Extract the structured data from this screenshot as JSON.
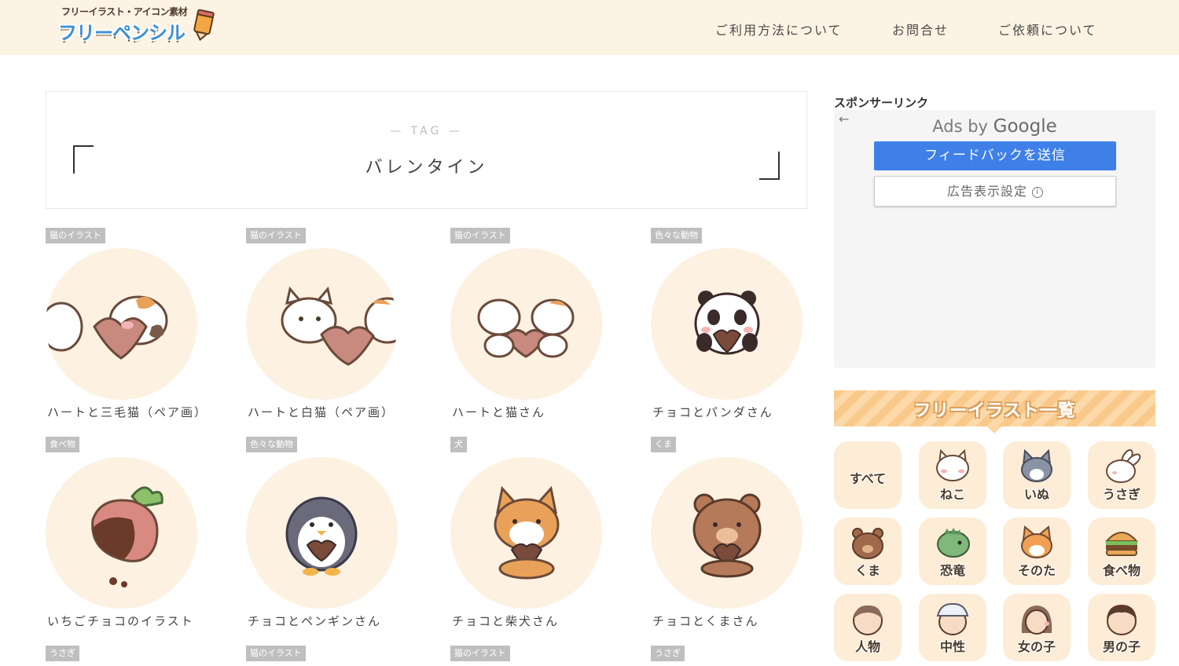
{
  "header": {
    "logo_sub": "フリーイラスト・アイコン素材",
    "logo_main": "フリーペンシル",
    "nav": [
      "ご利用方法について",
      "お問合せ",
      "ご依頼について"
    ]
  },
  "tag": {
    "label": "— TAG —",
    "title": "バレンタイン"
  },
  "cards": [
    {
      "category": "猫のイラスト",
      "title": "ハートと三毛猫（ペア画）",
      "icon": "calico-cat-heart-illustration"
    },
    {
      "category": "猫のイラスト",
      "title": "ハートと白猫（ペア画）",
      "icon": "white-cat-heart-illustration"
    },
    {
      "category": "猫のイラスト",
      "title": "ハートと猫さん",
      "icon": "cats-pair-heart-illustration"
    },
    {
      "category": "色々な動物",
      "title": "チョコとパンダさん",
      "icon": "panda-chocolate-illustration"
    },
    {
      "category": "食べ物",
      "title": "いちごチョコのイラスト",
      "icon": "strawberry-chocolate-illustration"
    },
    {
      "category": "色々な動物",
      "title": "チョコとペンギンさん",
      "icon": "penguin-chocolate-illustration"
    },
    {
      "category": "犬",
      "title": "チョコと柴犬さん",
      "icon": "shiba-chocolate-illustration"
    },
    {
      "category": "くま",
      "title": "チョコとくまさん",
      "icon": "bear-chocolate-illustration"
    },
    {
      "category": "うさぎ"
    },
    {
      "category": "猫のイラスト"
    },
    {
      "category": "猫のイラスト"
    },
    {
      "category": "うさぎ"
    }
  ],
  "sidebar": {
    "sponsor_label": "スポンサーリンク",
    "ads_by": "Ads by",
    "ads_google": "Google",
    "feedback_button": "フィードバックを送信",
    "ad_settings_button": "広告表示設定",
    "back_arrow": "←",
    "info_glyph": "i",
    "list_title": "フリーイラスト一覧",
    "categories": [
      "すべて",
      "ねこ",
      "いぬ",
      "うさぎ",
      "くま",
      "恐竜",
      "そのた",
      "食べ物",
      "人物",
      "中性",
      "女の子",
      "男の子"
    ]
  },
  "colors": {
    "header_bg": "#fdf3e4",
    "thumb_bg": "#fdf1e1",
    "badge_bg": "#bfbfbf",
    "feedback_blue": "#3e80e8",
    "category_bg": "#fdecd6",
    "banner_orange": "#f9c98b",
    "logo_blue": "#3b8fd8"
  }
}
